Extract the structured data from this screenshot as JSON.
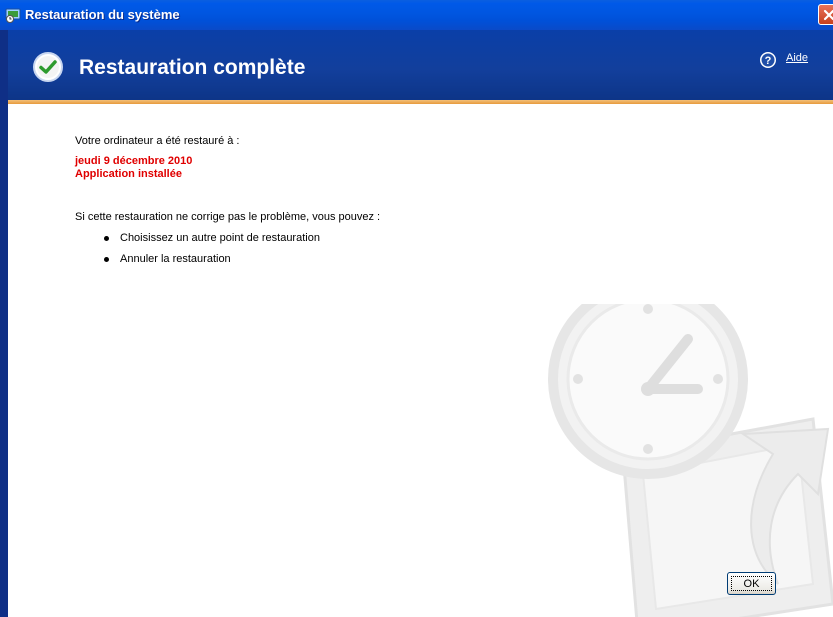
{
  "window": {
    "title": "Restauration du système",
    "icon": "system-restore-icon",
    "close_icon": "close-icon"
  },
  "banner": {
    "heading": "Restauration complète",
    "icon": "success-check-icon",
    "help_label": "Aide",
    "help_icon": "help-icon"
  },
  "content": {
    "intro": "Votre ordinateur a été restauré à :",
    "restore_date": "jeudi 9 décembre 2010",
    "restore_point": "Application installée",
    "options_intro": "Si cette restauration ne corrige pas le problème, vous pouvez :",
    "options": [
      {
        "label": "Choisissez un autre point de restauration"
      },
      {
        "label": "Annuler la restauration"
      }
    ]
  },
  "buttons": {
    "ok_label": "OK"
  },
  "colors": {
    "title_bar": "#0058e6",
    "banner": "#123f9c",
    "banner_accent": "#e69a3c",
    "restore_text": "#e00000"
  }
}
